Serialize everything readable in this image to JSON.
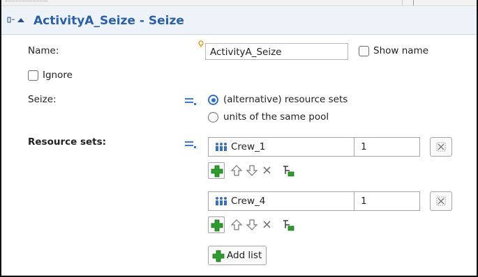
{
  "section": {
    "title": "ActivityA_Seize - Seize",
    "collapse_icon": "collapse-panel-icon"
  },
  "name_field": {
    "label": "Name:",
    "value": "ActivityA_Seize",
    "show_name_label": "Show name",
    "show_name_checked": false
  },
  "ignore": {
    "label": "Ignore",
    "checked": false
  },
  "seize": {
    "label": "Seize:",
    "options": [
      {
        "label": "(alternative) resource sets",
        "selected": true
      },
      {
        "label": "units of the same pool",
        "selected": false
      }
    ]
  },
  "resource_sets": {
    "label": "Resource sets:",
    "lists": [
      {
        "resource": "Crew_1",
        "quantity": "1"
      },
      {
        "resource": "Crew_4",
        "quantity": "1"
      }
    ],
    "add_list_label": "Add list"
  },
  "colors": {
    "accent": "#2b5fa8",
    "header_bg": "#eef3fa",
    "add_green": "#2e9c2e"
  }
}
